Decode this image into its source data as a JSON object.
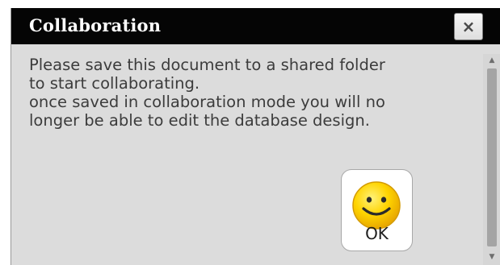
{
  "dialog": {
    "title": "Collaboration",
    "close_label": "×",
    "message_lines": [
      "Please save this document to a shared folder",
      "to start collaborating.",
      "once saved in collaboration mode you will no",
      "longer be able to edit the database design."
    ],
    "ok_label": "OK",
    "ok_icon": "smiley-face-icon"
  },
  "scrollbar": {
    "up_icon": "▲",
    "down_icon": "▼"
  },
  "colors": {
    "titlebar": "#050505",
    "body": "#dcdcdc",
    "smiley_face": "#ffd400",
    "text": "#3c3c3c"
  }
}
